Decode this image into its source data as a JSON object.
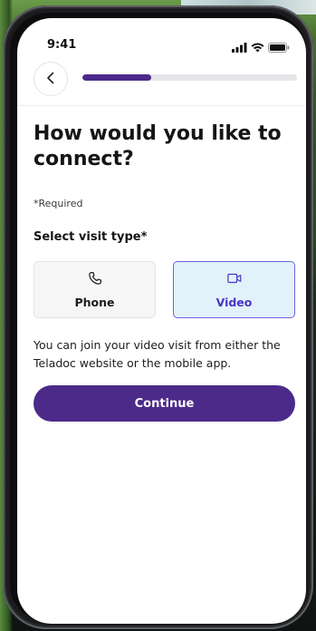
{
  "status_bar": {
    "time": "9:41",
    "icons": [
      "signal-icon",
      "wifi-icon",
      "battery-icon"
    ]
  },
  "header": {
    "back_icon": "chevron-left-icon",
    "progress": 0.32
  },
  "main": {
    "title": "How would you like to connect?",
    "required_note": "*Required",
    "select_label": "Select visit type*",
    "options": [
      {
        "label": "Phone",
        "icon": "phone-icon",
        "selected": false
      },
      {
        "label": "Video",
        "icon": "video-icon",
        "selected": true
      }
    ],
    "info_text": "You can join your video visit from either the Teladoc website or the mobile app.",
    "continue_label": "Continue"
  },
  "colors": {
    "brand_purple": "#4b2a8a",
    "selected_border": "#6f62d8",
    "selected_bg": "#e2f2fb",
    "selected_text": "#4a35c2"
  }
}
